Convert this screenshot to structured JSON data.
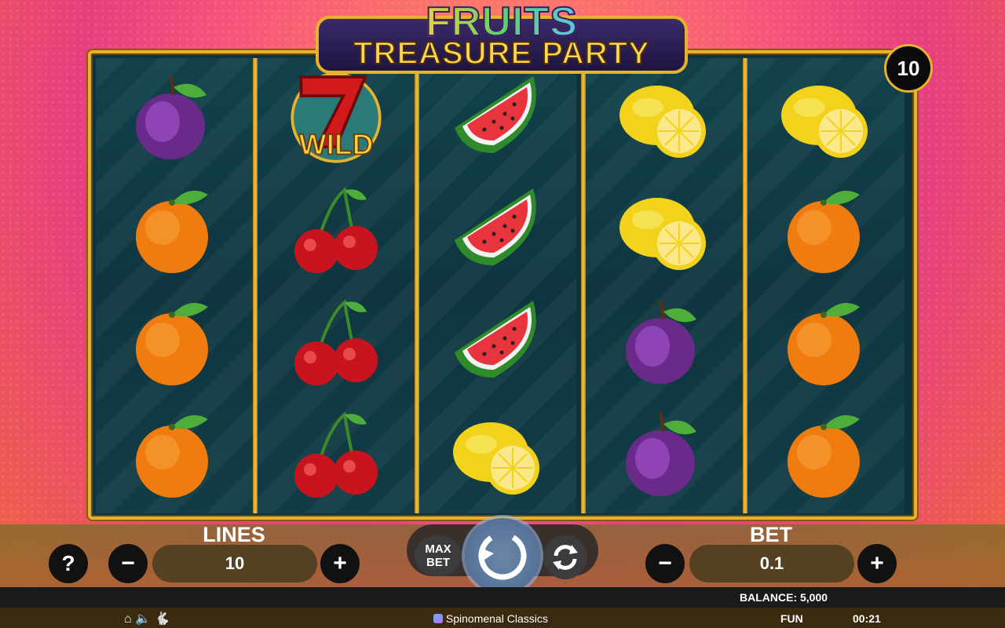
{
  "game": {
    "title_line1": "FRUITS",
    "title_line2": "TREASURE PARTY",
    "active_lines_badge": "10"
  },
  "reels": [
    [
      "plum",
      "orange",
      "orange",
      "orange"
    ],
    [
      "wild-seven",
      "cherry",
      "cherry",
      "cherry"
    ],
    [
      "watermelon",
      "watermelon",
      "watermelon",
      "lemon"
    ],
    [
      "lemon",
      "lemon",
      "plum",
      "plum"
    ],
    [
      "lemon",
      "orange",
      "orange",
      "orange"
    ]
  ],
  "wild_label": "WILD",
  "controls": {
    "help_label": "?",
    "lines_label": "LINES",
    "lines_value": "10",
    "minus": "−",
    "plus": "+",
    "max_bet_label": "MAX\nBET",
    "bet_label": "BET",
    "bet_value": "0.1"
  },
  "status": {
    "balance": "BALANCE: 5,000",
    "provider": "Spinomenal Classics",
    "mode": "FUN",
    "time": "00:21"
  },
  "colors": {
    "gold": "#e8b32a",
    "reel_bg": "#10323b"
  }
}
